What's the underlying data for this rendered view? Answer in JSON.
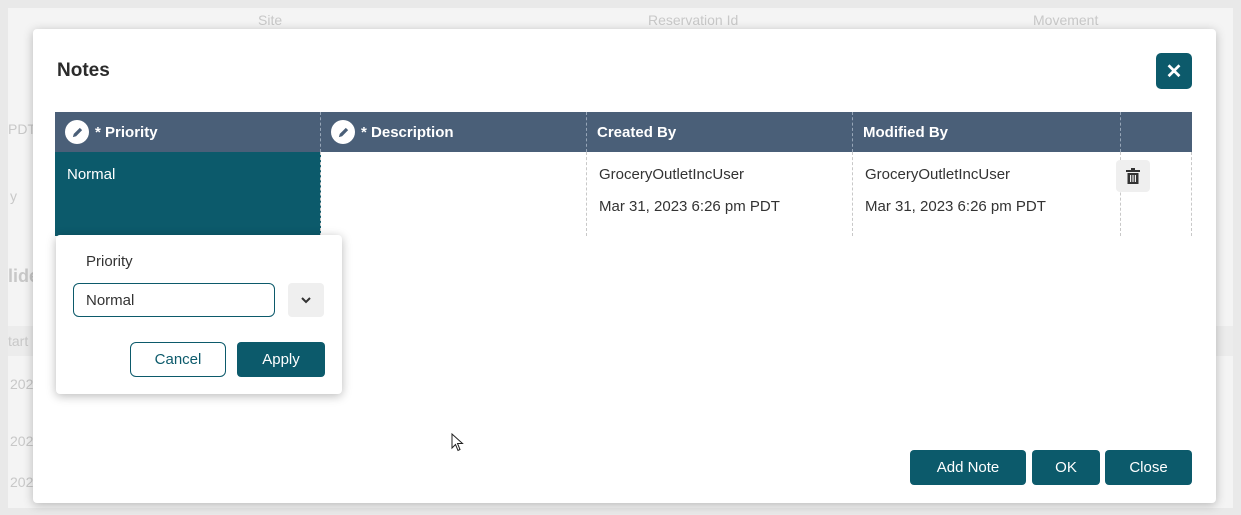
{
  "background": {
    "header_cols": [
      "Site",
      "Reservation Id",
      "Movement"
    ],
    "side_fragments": [
      "PDT",
      "y",
      "lide",
      "tart",
      "202",
      "202",
      "202"
    ]
  },
  "modal": {
    "title": "Notes",
    "close_icon": "close-icon",
    "columns": [
      {
        "label": "Priority",
        "required": "*",
        "editable": true,
        "icon": "pencil-icon"
      },
      {
        "label": "Description",
        "required": "*",
        "editable": true,
        "icon": "pencil-icon"
      },
      {
        "label": "Created By"
      },
      {
        "label": "Modified By"
      },
      {
        "label": ""
      }
    ],
    "rows": [
      {
        "priority": "Normal",
        "description": "",
        "created_by_user": "GroceryOutletIncUser",
        "created_by_date": "Mar 31, 2023 6:26 pm PDT",
        "modified_by_user": "GroceryOutletIncUser",
        "modified_by_date": "Mar 31, 2023 6:26 pm PDT",
        "delete_icon": "trash-icon"
      }
    ],
    "popover": {
      "label": "Priority",
      "value": "Normal",
      "cancel_label": "Cancel",
      "apply_label": "Apply"
    },
    "footer": {
      "add_note_label": "Add Note",
      "ok_label": "OK",
      "close_label": "Close"
    }
  },
  "colors": {
    "accent": "#0c5a6b",
    "header_bg": "#4a5f78"
  }
}
